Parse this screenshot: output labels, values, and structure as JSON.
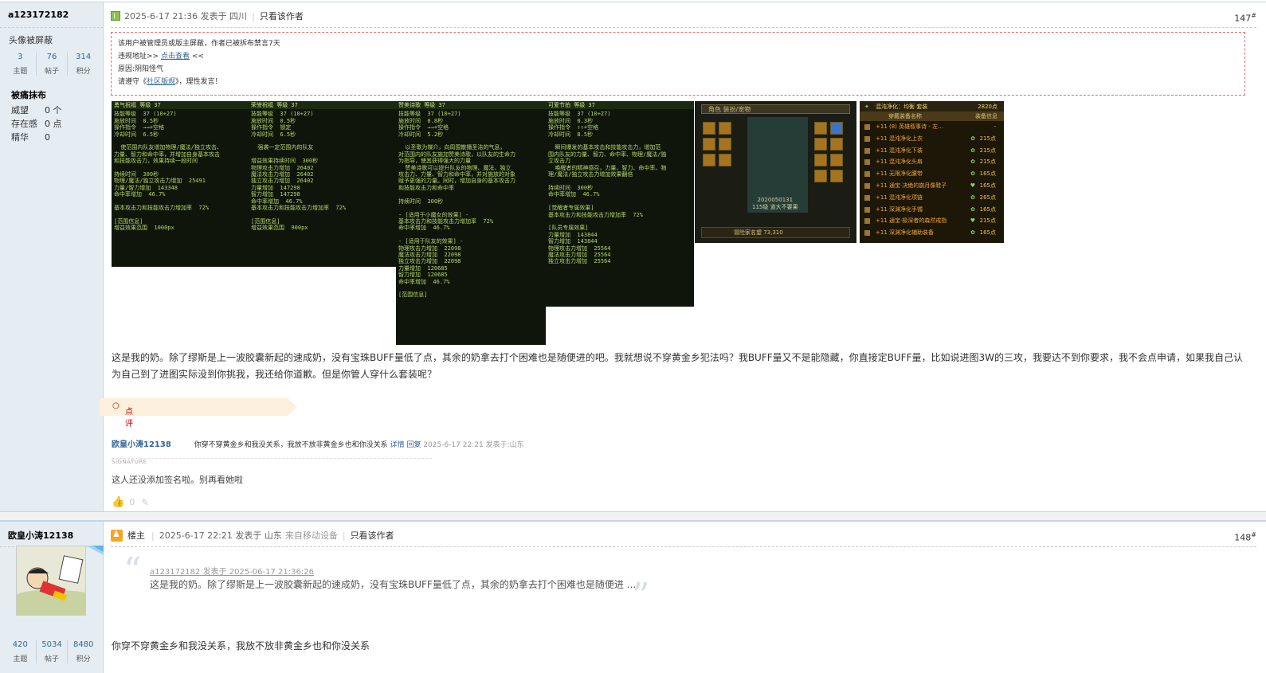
{
  "post1": {
    "author": "a123172182",
    "avatar_note": "头像被屏蔽",
    "stats": [
      {
        "value": "3",
        "label": "主题"
      },
      {
        "value": "76",
        "label": "帖子"
      },
      {
        "value": "314",
        "label": "积分"
      }
    ],
    "banned_title": "被痛抹布",
    "attrs": [
      {
        "key": "威望",
        "value": "0 个"
      },
      {
        "key": "存在感",
        "value": "0 点"
      },
      {
        "key": "精华",
        "value": "0"
      }
    ],
    "post_time": "2025-6-17 21:36 发表于 四川",
    "only_author": "只看该作者",
    "floor": "147",
    "ban_notice": {
      "line1": "该用户被管理员或版主屏蔽，作者已被拆布禁言7天",
      "line2_prefix": "违规地址>> ",
      "line2_link": "点击查看",
      "line2_suffix": " <<",
      "line3": "原因:阴阳怪气",
      "line4_prefix": "请遵守《",
      "line4_link": "社区版规",
      "line4_suffix": "》，理性发言！"
    },
    "screens": [
      {
        "title": "勇气祝福 等级 37",
        "body": "技能等级  37 (10+27)\n施放时间  0.5秒\n操作指令  →→+空格\n冷却时间  6.5秒\n\n  使范围内队友增加物理/魔法/独立攻击、\n力量、智力和命中率，并增加自身基本攻击\n和技能攻击力，效果持续一段时间\n\n持续时间  300秒\n物理/魔法/独立攻击力增加  25491\n力量/智力增加  143348\n命中率增加  46.7%\n\n基本攻击力和技能攻击力增加率  72%\n\n[范围信息]\n增益效果范围  1000px"
      },
      {
        "title": "荣誉祝福 等级 37",
        "body": "技能等级  37 (10+27)\n施放时间  0.5秒\n操作指令  锁定\n冷却时间  6.5秒\n\n  强袭一定范围内的队友\n\n增益效果持续时间  300秒\n物理攻击力增加  26402\n魔法攻击力增加  26402\n独立攻击力增加  26402\n力量增加  147298\n智力增加  147298\n命中率增加  46.7%\n基本攻击力和技能攻击力增加率  72%\n\n[范围信息]\n增益效果范围  900px"
      },
      {
        "title": "赞美诗歌 等级 37",
        "body": "技能等级  37 (10+27)\n施放时间  0.8秒\n操作指令  →→+空格\n冷却时间  5.2秒\n\n  以圣歌为媒介，向周围散播圣洁的气息，\n对范围内的队友施加赞美诗歌，以队友的生命力\n为指导，使其获得强大的力量\n  赞美诗歌可以提升队友的物理、魔法、独立\n攻击力、力量、智力和命中率，并对施放的对象\n赋予更强的力量。同时，增加自身的基本攻击力\n和技能攻击力和命中率\n\n持续时间  300秒\n\n- [适用于小魔女的效果] -\n基本攻击力和技能攻击力增加率  72%\n命中率增加  46.7%\n\n- [适用于队友的效果] -\n物理攻击力增加  22098\n魔法攻击力增加  22098\n独立攻击力增加  22098\n力量增加  120685\n智力增加  120685\n命中率增加  46.7%\n\n[范围信息]"
      },
      {
        "title": "可爱节拍 等级 37",
        "body": "技能等级  37 (10+27)\n施放时间  0.3秒\n操作指令  ↑↑+空格\n冷却时间  8.5秒\n\n  瞬间爆发的基本攻击和技能攻击力，增加范\n围内队友的力量、智力、命中率、物理/魔法/独\n立攻击力\n  唤醒者的精神感召，力量、智力、命中率、物\n理/魔法/独立攻击力增加效果翻倍\n\n持续时间  300秒\n命中率增加  46.7%\n\n[觉醒者专属效果]\n基本攻击力和技能攻击力增加率  72%\n\n[队员专属效果]\n力量增加  143844\n智力增加  143844\n物理攻击力增加  25564\n魔法攻击力增加  25564\n独立攻击力增加  25564"
      }
    ],
    "gear_panel": {
      "tabs": "角色   装扮/宠物",
      "caption": "2020050131\n115级 道大不要果",
      "bottom": "冒险家名望 73,310"
    },
    "equip_panel": {
      "header": "混沌净化：均衡 套装",
      "header_points": "2820点",
      "col1": "穿戴装备名称",
      "col2": "装备信息",
      "rows": [
        {
          "name": "+11 (8) 英雄叙事诗 - 左...",
          "points": "-"
        },
        {
          "name": "+11 混沌净化上衣",
          "points": "215点"
        },
        {
          "name": "+11 混沌净化下装",
          "points": "215点"
        },
        {
          "name": "+11 混沌净化头肩",
          "points": "215点"
        },
        {
          "name": "+11 无限净化腰带",
          "points": "165点"
        },
        {
          "name": "+11 通宝·决绝的崩月像鞋子",
          "points": "165点"
        },
        {
          "name": "+11 混沌净化项链",
          "points": "265点"
        },
        {
          "name": "+11 深渊净化手镯",
          "points": "165点"
        },
        {
          "name": "+11 通宝·极深者的森然戒指",
          "points": "215点"
        },
        {
          "name": "+11 深渊净化辅助装备",
          "points": "165点"
        }
      ]
    },
    "body": "这是我的奶。除了缪斯是上一波胶囊新起的速成奶，没有宝珠BUFF量低了点，其余的奶拿去打个困难也是随便进的吧。我就想说不穿黄金乡犯法吗？我BUFF量又不是能隐藏，你直接定BUFF量，比如说进图3W的三攻，我要达不到你要求，我不会点申请，如果我自己认为自己到了进图实际没到你挑我，我还给你道歉。但是你管人穿什么套装呢？",
    "rate_label": "点评",
    "comment": {
      "author": "欧皇小涛12138",
      "text": "你穿不穿黄金乡和我没关系，我放不放非黄金乡也和你没关系",
      "detail": "详情",
      "reply": "回复",
      "meta": "2025-6-17 22:21 发表于:山东"
    },
    "signature_label": "SIGNATURE",
    "signature": "这人还没添加签名啦。别再看她啦",
    "votes": "0"
  },
  "post2": {
    "author": "欧皇小涛12138",
    "stats": [
      {
        "value": "420",
        "label": "主题"
      },
      {
        "value": "5034",
        "label": "帖子"
      },
      {
        "value": "8480",
        "label": "积分"
      }
    ],
    "role": "楼主",
    "post_time": "2025-6-17 22:21 发表于 山东",
    "device": "来自移动设备",
    "only_author": "只看该作者",
    "floor": "148",
    "quote_head": "a123172182 发表于 2025-06-17 21:36:26",
    "quote_text": "这是我的奶。除了缪斯是上一波胶囊新起的速成奶，没有宝珠BUFF量低了点，其余的奶拿去打个困难也是随便进 ...",
    "reply": "你穿不穿黄金乡和我没关系，我放不放非黄金乡也和你没关系"
  }
}
